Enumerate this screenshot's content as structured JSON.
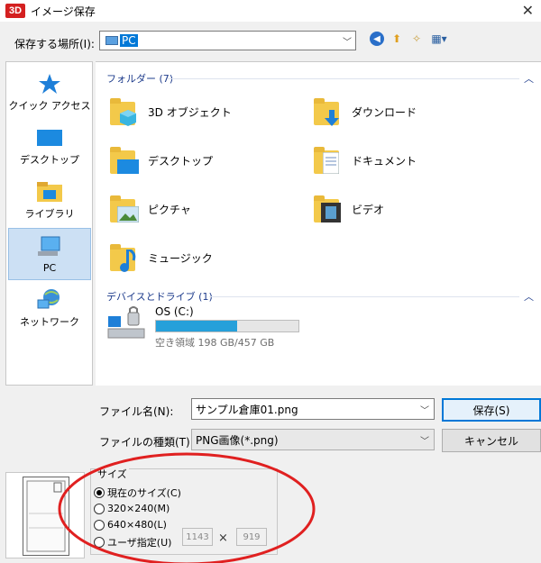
{
  "window": {
    "title": "イメージ保存",
    "logo": "3D",
    "close": "✕"
  },
  "location": {
    "label": "保存する場所(I):",
    "value": "PC"
  },
  "places": [
    {
      "label": "クイック アクセス",
      "icon": "star-icon"
    },
    {
      "label": "デスクトップ",
      "icon": "desktop-icon"
    },
    {
      "label": "ライブラリ",
      "icon": "library-icon"
    },
    {
      "label": "PC",
      "icon": "pc-icon",
      "active": true
    },
    {
      "label": "ネットワーク",
      "icon": "network-icon"
    }
  ],
  "groups": {
    "folders": {
      "header": "フォルダー (7)"
    },
    "devices": {
      "header": "デバイスとドライブ (1)"
    }
  },
  "folders": [
    {
      "label": "3D オブジェクト",
      "icon": "3d-objects-folder-icon"
    },
    {
      "label": "ダウンロード",
      "icon": "downloads-folder-icon"
    },
    {
      "label": "デスクトップ",
      "icon": "desktop-folder-icon"
    },
    {
      "label": "ドキュメント",
      "icon": "documents-folder-icon"
    },
    {
      "label": "ピクチャ",
      "icon": "pictures-folder-icon"
    },
    {
      "label": "ビデオ",
      "icon": "videos-folder-icon"
    },
    {
      "label": "ミュージック",
      "icon": "music-folder-icon"
    }
  ],
  "drive": {
    "name": "OS (C:)",
    "space": "空き領域 198 GB/457 GB",
    "used_fraction": 0.567
  },
  "filename": {
    "label": "ファイル名(N):",
    "value": "サンプル倉庫01.png"
  },
  "filetype": {
    "label": "ファイルの種類(T):",
    "value": "PNG画像(*.png)"
  },
  "buttons": {
    "save": "保存(S)",
    "cancel": "キャンセル"
  },
  "size": {
    "title": "サイズ",
    "options": [
      {
        "label": "現在のサイズ(C)",
        "selected": true
      },
      {
        "label": "320×240(M)",
        "selected": false
      },
      {
        "label": "640×480(L)",
        "selected": false
      },
      {
        "label": "ユーザ指定(U)",
        "selected": false
      }
    ],
    "custom_width": "1143",
    "custom_height": "919",
    "times": "×"
  },
  "colors": {
    "accent": "#0078d7",
    "highlight": "#cce0f4",
    "annotation": "#e02020",
    "drive_fill": "#26a0da"
  }
}
